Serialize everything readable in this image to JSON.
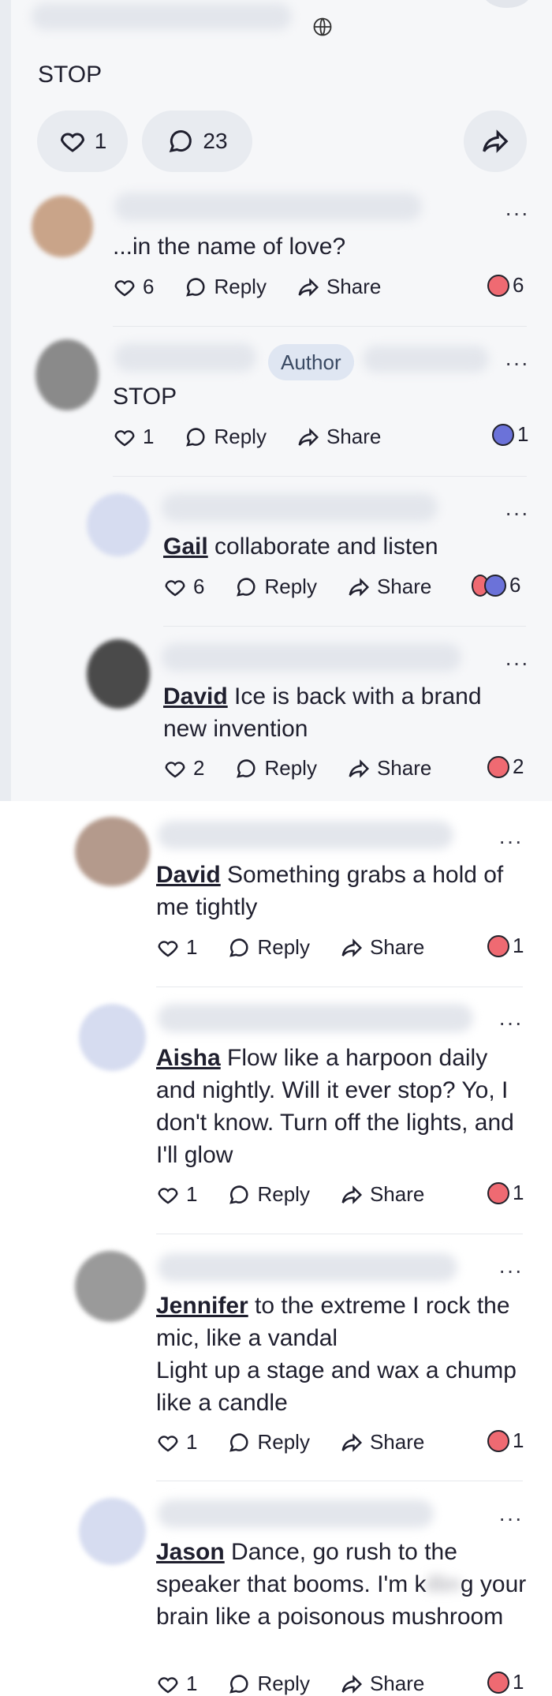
{
  "post": {
    "text": "STOP",
    "likes": "1",
    "comments": "23"
  },
  "labels": {
    "reply": "Reply",
    "share": "Share",
    "author": "Author",
    "more": "···"
  },
  "comments": [
    {
      "mention": "",
      "text": "...in the name of love?",
      "likes": "6",
      "reaction_count": "6"
    },
    {
      "mention": "",
      "text": "STOP",
      "likes": "1",
      "reaction_count": "1"
    },
    {
      "mention": "Gail",
      "text": " collaborate and listen",
      "likes": "6",
      "reaction_count": "6"
    },
    {
      "mention": "David",
      "text": " Ice is back with a brand new invention",
      "likes": "2",
      "reaction_count": "2"
    },
    {
      "mention": "David",
      "text": " Something grabs a hold of me tightly",
      "likes": "1",
      "reaction_count": "1"
    },
    {
      "mention": "Aisha",
      "text": " Flow like a harpoon daily and nightly. Will it ever stop? Yo, I don't know. Turn off the lights, and I'll glow",
      "likes": "1",
      "reaction_count": "1"
    },
    {
      "mention": "Jennifer",
      "text": " to the extreme I rock the mic, like a vandal",
      "text2": "Light up a stage and wax a chump like a candle",
      "likes": "1",
      "reaction_count": "1"
    },
    {
      "mention": "Jason",
      "text": " Dance, go rush to the speaker that booms. I'm k",
      "text_hidden": "illin",
      "text_end": "g your brain like a poisonous mushroom",
      "likes": "1",
      "reaction_count": "1"
    }
  ],
  "colors": {
    "heart_reaction": "#ef6a72",
    "surprised_reaction": "#6b72d9",
    "badge_bg": "#dfe6f2"
  }
}
